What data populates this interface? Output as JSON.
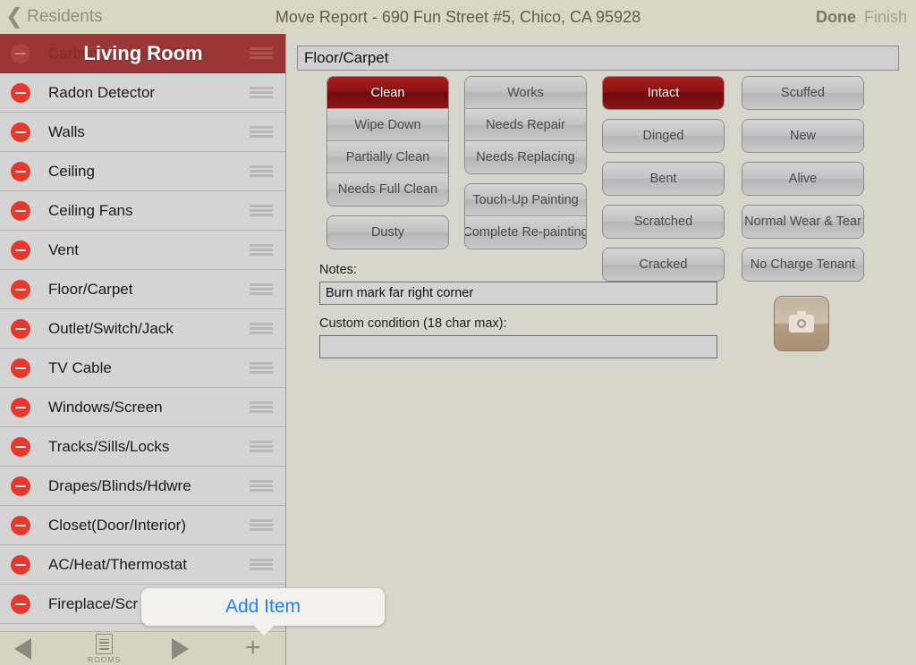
{
  "navbar": {
    "back_label": "Residents",
    "back_chevron": "chevron-left-icon",
    "title": "Move Report - 690 Fun Street #5, Chico, CA 95928",
    "done_label": "Done",
    "finish_label": "Finish"
  },
  "sidebar": {
    "room_overlay": "Living Room",
    "items": [
      {
        "label": "Carbon Monoxide Dete…",
        "selected": true
      },
      {
        "label": "Radon Detector",
        "selected": false
      },
      {
        "label": "Walls",
        "selected": false
      },
      {
        "label": "Ceiling",
        "selected": false
      },
      {
        "label": "Ceiling Fans",
        "selected": false
      },
      {
        "label": "Vent",
        "selected": false
      },
      {
        "label": "Floor/Carpet",
        "selected": false
      },
      {
        "label": "Outlet/Switch/Jack",
        "selected": false
      },
      {
        "label": "TV Cable",
        "selected": false
      },
      {
        "label": "Windows/Screen",
        "selected": false
      },
      {
        "label": "Tracks/Sills/Locks",
        "selected": false
      },
      {
        "label": "Drapes/Blinds/Hdwre",
        "selected": false
      },
      {
        "label": "Closet(Door/Interior)",
        "selected": false
      },
      {
        "label": "AC/Heat/Thermostat",
        "selected": false
      },
      {
        "label": "Fireplace/Scr",
        "selected": false
      }
    ]
  },
  "toolbar": {
    "prev_icon": "triangle-left-icon",
    "rooms_icon": "list-document-icon",
    "rooms_label": "ROOMS",
    "next_icon": "triangle-right-icon",
    "add_icon": "plus-icon"
  },
  "popover": {
    "label": "Add Item"
  },
  "main": {
    "item_title": "Floor/Carpet",
    "columns": [
      {
        "groups": [
          {
            "options": [
              {
                "label": "Clean",
                "selected": true
              },
              {
                "label": "Wipe Down",
                "selected": false
              },
              {
                "label": "Partially Clean",
                "selected": false
              },
              {
                "label": "Needs Full Clean",
                "selected": false
              }
            ]
          },
          {
            "options": [
              {
                "label": "Dusty",
                "selected": false
              }
            ]
          }
        ]
      },
      {
        "groups": [
          {
            "options": [
              {
                "label": "Works",
                "selected": false
              },
              {
                "label": "Needs Repair",
                "selected": false
              },
              {
                "label": "Needs Replacing",
                "selected": false
              }
            ]
          },
          {
            "options": [
              {
                "label": "Touch-Up Painting",
                "selected": false
              },
              {
                "label": "Complete Re-painting",
                "selected": false
              }
            ]
          }
        ]
      },
      {
        "groups": [
          {
            "options": [
              {
                "label": "Intact",
                "selected": true
              }
            ]
          },
          {
            "options": [
              {
                "label": "Dinged",
                "selected": false
              }
            ]
          },
          {
            "options": [
              {
                "label": "Bent",
                "selected": false
              }
            ]
          },
          {
            "options": [
              {
                "label": "Scratched",
                "selected": false
              }
            ]
          },
          {
            "options": [
              {
                "label": "Cracked",
                "selected": false
              }
            ]
          }
        ]
      },
      {
        "groups": [
          {
            "options": [
              {
                "label": "Scuffed",
                "selected": false
              }
            ]
          },
          {
            "options": [
              {
                "label": "New",
                "selected": false
              }
            ]
          },
          {
            "options": [
              {
                "label": "Alive",
                "selected": false
              }
            ]
          },
          {
            "options": [
              {
                "label": "Normal Wear & Tear",
                "selected": false
              }
            ]
          },
          {
            "options": [
              {
                "label": "No Charge Tenant",
                "selected": false
              }
            ]
          }
        ]
      }
    ],
    "notes_label": "Notes:",
    "notes_value": "Burn mark far right corner",
    "custom_label": "Custom condition (18 char max):",
    "custom_value": "",
    "camera_icon": "camera-icon"
  },
  "colors": {
    "navbar_bg": "#d8d7c4",
    "content_bg": "#d6d6cc",
    "sidebar_bg": "#d4d4d4",
    "selected_row": "#9c3636",
    "selected_button": "#8e1313",
    "delete_red": "#e8382b",
    "link_blue": "#1f82f5"
  }
}
